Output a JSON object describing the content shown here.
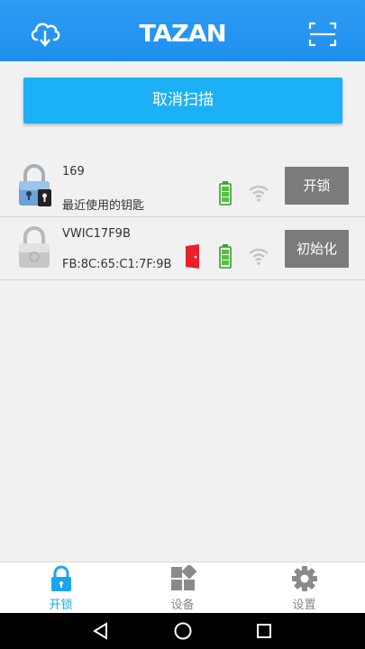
{
  "header": {
    "logo_text": "TAZAN",
    "left_icon": "cloud-download-icon",
    "right_icon": "scan-frame-icon",
    "color": "#2196f3"
  },
  "scan_button": {
    "label": "取消扫描"
  },
  "devices": [
    {
      "name": "169",
      "subtitle": "最近使用的钥匙",
      "lock_icon": "padlock-with-key-icon",
      "battery_icon": "battery-icon",
      "signal_icon": "wifi-signal-icon",
      "action_label": "开锁"
    },
    {
      "name": "VWIC17F9B",
      "subtitle": "FB:8C:65:C1:7F:9B",
      "lock_icon": "padlock-icon",
      "door_icon": "door-icon",
      "battery_icon": "battery-icon",
      "signal_icon": "wifi-signal-icon",
      "action_label": "初始化"
    }
  ],
  "tabs": [
    {
      "label": "开锁",
      "icon": "lock-icon",
      "active": true
    },
    {
      "label": "设备",
      "icon": "grid-icon",
      "active": false
    },
    {
      "label": "设置",
      "icon": "gear-icon",
      "active": false
    }
  ],
  "colors": {
    "accent": "#1cb0f6",
    "active_tab": "#1aa6ee",
    "inactive_tab": "#8a8a8a",
    "action_button": "#7b7b7b"
  },
  "nav_bar": {
    "back_icon": "back-triangle-icon",
    "home_icon": "home-circle-icon",
    "recent_icon": "recent-square-icon"
  }
}
